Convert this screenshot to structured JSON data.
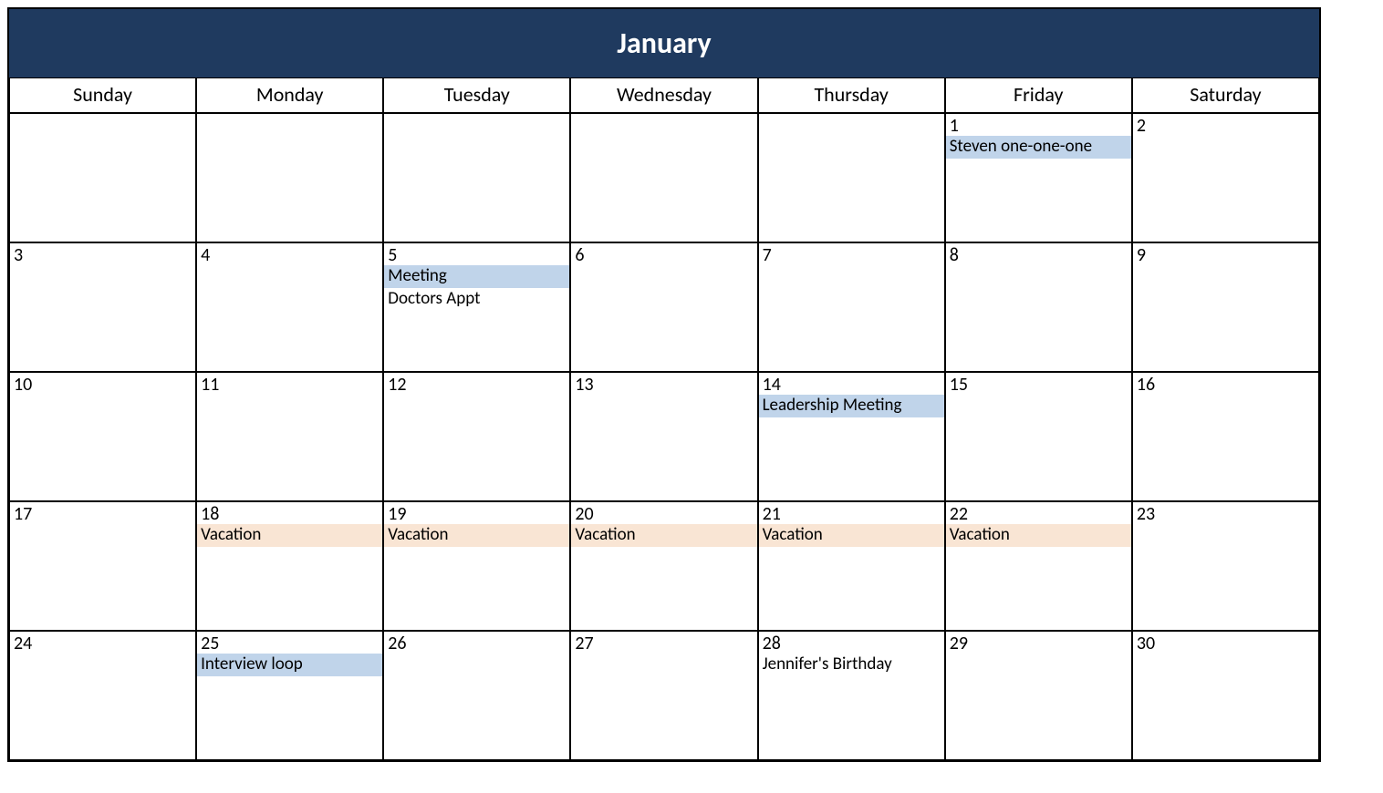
{
  "month_title": "January",
  "weekdays": [
    "Sunday",
    "Monday",
    "Tuesday",
    "Wednesday",
    "Thursday",
    "Friday",
    "Saturday"
  ],
  "colors": {
    "header_bg": "#1f3a5f",
    "event_blue": "#c0d4ea",
    "event_peach": "#f9e5d4"
  },
  "weeks": [
    [
      {
        "day": "",
        "events": []
      },
      {
        "day": "",
        "events": []
      },
      {
        "day": "",
        "events": []
      },
      {
        "day": "",
        "events": []
      },
      {
        "day": "",
        "events": []
      },
      {
        "day": "1",
        "events": [
          {
            "label": "Steven one-one-one",
            "style": "blue"
          }
        ]
      },
      {
        "day": "2",
        "events": []
      }
    ],
    [
      {
        "day": "3",
        "events": []
      },
      {
        "day": "4",
        "events": []
      },
      {
        "day": "5",
        "events": [
          {
            "label": "Meeting",
            "style": "blue"
          },
          {
            "label": "Doctors Appt",
            "style": "plain"
          }
        ]
      },
      {
        "day": "6",
        "events": []
      },
      {
        "day": "7",
        "events": []
      },
      {
        "day": "8",
        "events": []
      },
      {
        "day": "9",
        "events": []
      }
    ],
    [
      {
        "day": "10",
        "events": []
      },
      {
        "day": "11",
        "events": []
      },
      {
        "day": "12",
        "events": []
      },
      {
        "day": "13",
        "events": []
      },
      {
        "day": "14",
        "events": [
          {
            "label": "Leadership Meeting",
            "style": "blue"
          }
        ]
      },
      {
        "day": "15",
        "events": []
      },
      {
        "day": "16",
        "events": []
      }
    ],
    [
      {
        "day": "17",
        "events": []
      },
      {
        "day": "18",
        "events": [
          {
            "label": "Vacation",
            "style": "peach"
          }
        ]
      },
      {
        "day": "19",
        "events": [
          {
            "label": "Vacation",
            "style": "peach"
          }
        ]
      },
      {
        "day": "20",
        "events": [
          {
            "label": "Vacation",
            "style": "peach"
          }
        ]
      },
      {
        "day": "21",
        "events": [
          {
            "label": "Vacation",
            "style": "peach"
          }
        ]
      },
      {
        "day": "22",
        "events": [
          {
            "label": "Vacation",
            "style": "peach"
          }
        ]
      },
      {
        "day": "23",
        "events": []
      }
    ],
    [
      {
        "day": "24",
        "events": []
      },
      {
        "day": "25",
        "events": [
          {
            "label": "Interview loop",
            "style": "blue"
          }
        ]
      },
      {
        "day": "26",
        "events": []
      },
      {
        "day": "27",
        "events": []
      },
      {
        "day": "28",
        "events": [
          {
            "label": "Jennifer's Birthday",
            "style": "plain"
          }
        ]
      },
      {
        "day": "29",
        "events": []
      },
      {
        "day": "30",
        "events": []
      }
    ]
  ]
}
